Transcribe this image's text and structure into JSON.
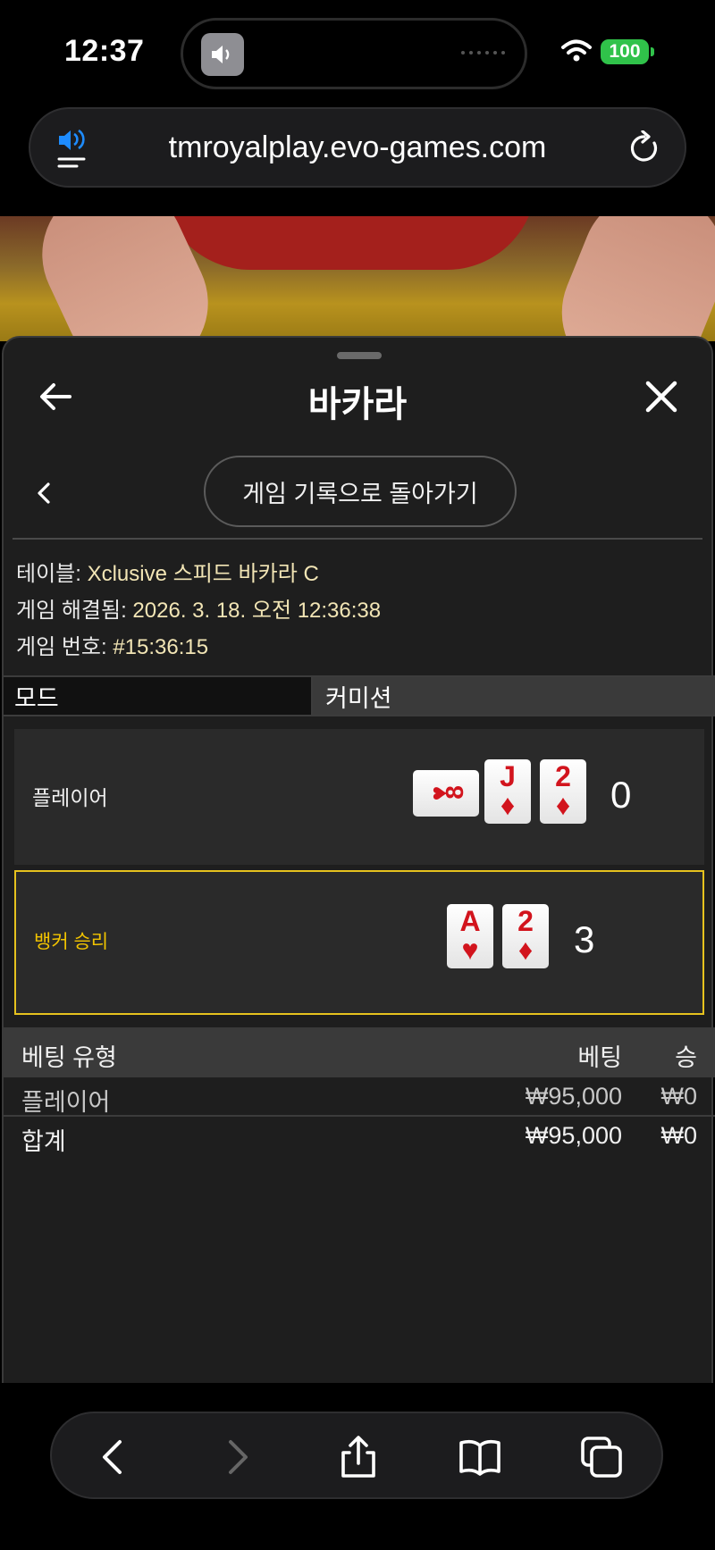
{
  "status_bar": {
    "time": "12:37",
    "battery": "100",
    "battery_color": "#30c24a"
  },
  "browser": {
    "url": "tmroyalplay.evo-games.com",
    "icons": [
      "speaker-menu-icon",
      "reload-icon"
    ]
  },
  "sheet": {
    "title": "바카라",
    "back_to_history": "게임 기록으로 돌아가기",
    "info": {
      "table_label": "테이블:",
      "table_value": "Xclusive 스피드 바카라 C",
      "resolved_label": "게임 해결됨:",
      "resolved_value": "2026. 3. 18. 오전 12:36:38",
      "number_label": "게임 번호:",
      "number_value": "#15:36:15"
    },
    "tabs": [
      {
        "label": "모드",
        "active": true
      },
      {
        "label": "커미션",
        "active": false
      }
    ],
    "hands": {
      "player": {
        "label": "플레이어",
        "score": "0",
        "cards": [
          {
            "rank": "8",
            "suit": "♥",
            "sideways": true
          },
          {
            "rank": "J",
            "suit": "♦"
          },
          {
            "rank": "2",
            "suit": "♦"
          }
        ]
      },
      "banker": {
        "label": "뱅커 승리",
        "score": "3",
        "highlight_color": "#e6c21e",
        "cards": [
          {
            "rank": "A",
            "suit": "♥"
          },
          {
            "rank": "2",
            "suit": "♦"
          }
        ]
      }
    },
    "bets": {
      "headers": {
        "type": "베팅 유형",
        "bet": "베팅",
        "win": "승"
      },
      "rows": [
        {
          "type": "플레이어",
          "bet": "₩95,000",
          "win": "₩0"
        }
      ],
      "total": {
        "type": "합계",
        "bet": "₩95,000",
        "win": "₩0"
      }
    }
  },
  "toolbar": {
    "icons": [
      "back-icon",
      "forward-icon",
      "share-icon",
      "bookmarks-icon",
      "tabs-icon"
    ]
  }
}
